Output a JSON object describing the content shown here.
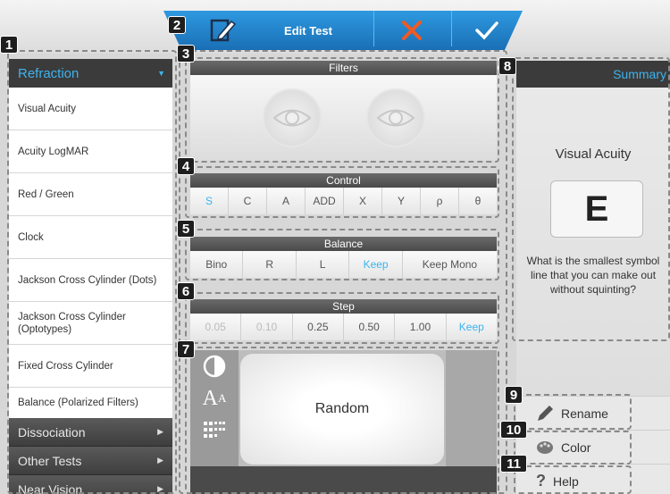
{
  "toolbar": {
    "title": "Edit Test",
    "edit_icon": "edit-test-icon",
    "cancel_icon": "close-icon",
    "confirm_icon": "checkmark-icon",
    "cancel_color": "#f05a22",
    "confirm_color": "#ffffff"
  },
  "sidebar": {
    "header": "Refraction",
    "items": [
      "Visual Acuity",
      "Acuity LogMAR",
      "Red / Green",
      "Clock",
      "Jackson Cross Cylinder (Dots)",
      "Jackson Cross Cylinder (Optotypes)",
      "Fixed Cross Cylinder",
      "Balance (Polarized Filters)"
    ],
    "categories": [
      "Dissociation",
      "Other Tests",
      "Near Vision"
    ]
  },
  "filters": {
    "title": "Filters"
  },
  "control": {
    "title": "Control",
    "buttons": [
      "S",
      "C",
      "A",
      "ADD",
      "X",
      "Y",
      "ρ",
      "θ"
    ],
    "active": "S"
  },
  "balance": {
    "title": "Balance",
    "buttons": [
      "Bino",
      "R",
      "L",
      "Keep",
      "Keep Mono"
    ],
    "active": "Keep"
  },
  "step": {
    "title": "Step",
    "buttons": [
      "0.05",
      "0.10",
      "0.25",
      "0.50",
      "1.00",
      "Keep"
    ],
    "active": "Keep",
    "disabled": [
      "0.05",
      "0.10"
    ]
  },
  "display": {
    "screen_text": "Random",
    "tools": [
      "contrast-icon",
      "font-size-icon",
      "grid-icon"
    ]
  },
  "summary": {
    "title": "Summary",
    "test_name": "Visual Acuity",
    "optotype": "E",
    "question": "What is the smallest symbol line that you can make out without squinting?"
  },
  "actions": {
    "rename": "Rename",
    "color": "Color",
    "help": "Help"
  },
  "markers": [
    "1",
    "2",
    "3",
    "4",
    "5",
    "6",
    "7",
    "8",
    "9",
    "10",
    "11"
  ],
  "colors": {
    "accent": "#3bb4ef",
    "toolbar": "#1f7fc9"
  }
}
